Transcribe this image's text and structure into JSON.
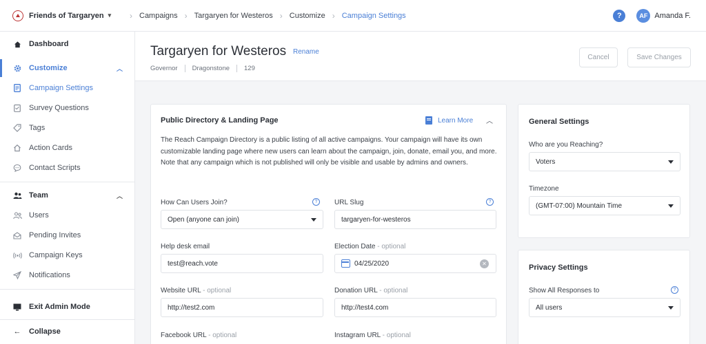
{
  "topbar": {
    "org_name": "Friends of Targaryen",
    "breadcrumbs": [
      "Campaigns",
      "Targaryen for Westeros",
      "Customize",
      "Campaign Settings"
    ],
    "help": "?",
    "avatar_initials": "AF",
    "user_name": "Amanda F."
  },
  "sidebar": {
    "dashboard": "Dashboard",
    "customize": "Customize",
    "customize_items": [
      "Campaign Settings",
      "Survey Questions",
      "Tags",
      "Action Cards",
      "Contact Scripts"
    ],
    "team": "Team",
    "team_items": [
      "Users",
      "Pending Invites",
      "Campaign Keys",
      "Notifications"
    ],
    "exit_admin": "Exit Admin Mode",
    "collapse": "Collapse"
  },
  "header": {
    "title": "Targaryen for Westeros",
    "rename": "Rename",
    "meta": [
      "Governor",
      "Dragonstone",
      "129"
    ],
    "cancel": "Cancel",
    "save": "Save Changes"
  },
  "directory": {
    "title": "Public Directory & Landing Page",
    "learn_more": "Learn More",
    "description": "The Reach Campaign Directory is a public listing of all active campaigns. Your campaign will have its own customizable landing page where new users can learn about the campaign, join, donate, email you, and more. Note that any campaign which is not published will only be visible and usable by admins and owners.",
    "how_join_label": "How Can Users Join?",
    "how_join_value": "Open (anyone can join)",
    "slug_label": "URL Slug",
    "slug_value": "targaryen-for-westeros",
    "helpdesk_label": "Help desk email",
    "helpdesk_value": "test@reach.vote",
    "election_label": "Election Date",
    "election_value": "04/25/2020",
    "website_label": "Website URL",
    "website_value": "http://test2.com",
    "donation_label": "Donation URL",
    "donation_value": "http://test4.com",
    "facebook_label": "Facebook URL",
    "instagram_label": "Instagram URL",
    "optional": "- optional"
  },
  "general": {
    "title": "General Settings",
    "reaching_label": "Who are you Reaching?",
    "reaching_value": "Voters",
    "timezone_label": "Timezone",
    "timezone_value": "(GMT-07:00) Mountain Time"
  },
  "privacy": {
    "title": "Privacy Settings",
    "show_label": "Show All Responses to",
    "show_value": "All users"
  }
}
